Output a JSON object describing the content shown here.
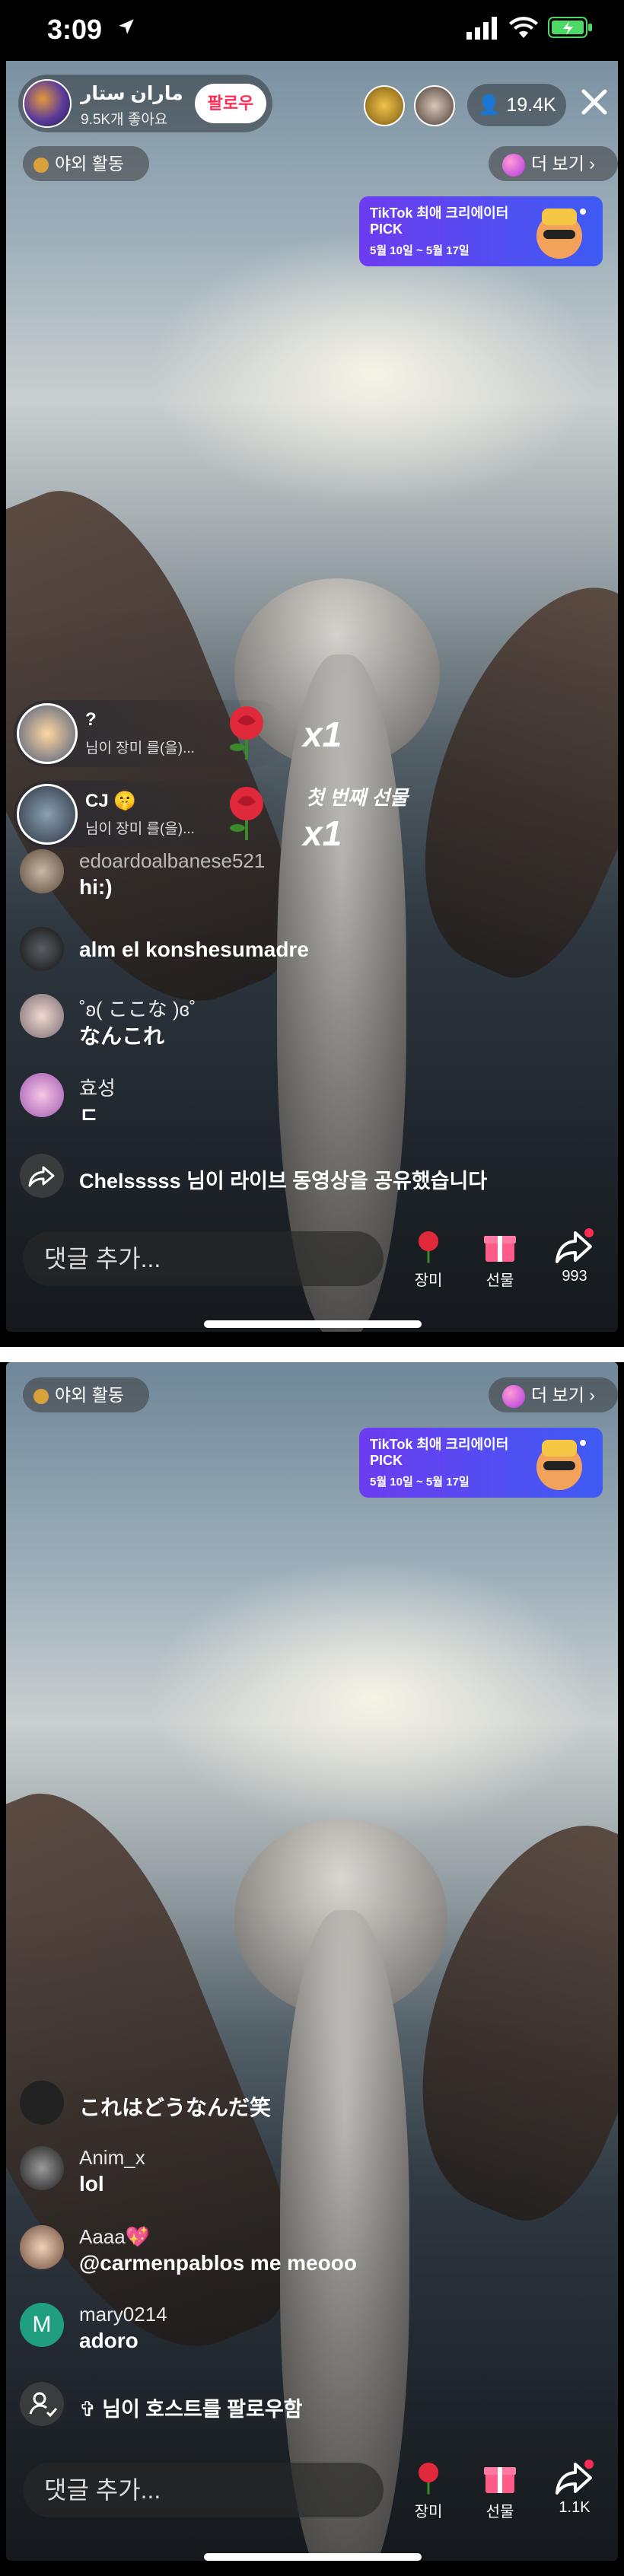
{
  "status_bar": {
    "time": "3:09"
  },
  "host": {
    "name": "ماران ستار",
    "likes": "9.5K개 좋아요",
    "follow_label": "팔로우"
  },
  "viewers": {
    "count": "19.4K"
  },
  "category_label": "야외 활동",
  "more_label": "더 보기",
  "banner": {
    "line1": "TikTok 최애 크리에이터",
    "line2": "PICK",
    "dates": "5월 10일 ~ 5월 17일"
  },
  "screen1": {
    "gifts": [
      {
        "name": "?",
        "sub": "님이 장미 를(을)...",
        "count": "x1"
      },
      {
        "name": "CJ 🤫",
        "sub": "님이 장미 를(을)...",
        "count": "x1",
        "note": "첫 번째 선물"
      }
    ],
    "comments": [
      {
        "name": "edoardoalbanese521",
        "text": "hi:)"
      },
      {
        "name": "",
        "text": "alm el konshesumadre"
      },
      {
        "name": "˚ʚ(  ここな  )ɞ˚",
        "text": "なんこれ"
      },
      {
        "name": "효성",
        "text": "ㄷ"
      },
      {
        "name": "",
        "text": "Chelsssss 님이 라이브 동영상을 공유했습니다"
      }
    ],
    "input_placeholder": "댓글 추가...",
    "actions": {
      "rose": "장미",
      "gift": "선물",
      "share": "993"
    }
  },
  "screen2": {
    "comments": [
      {
        "name": "",
        "text": "これはどうなんだ笑"
      },
      {
        "name": "Anim_x",
        "text": "lol"
      },
      {
        "name": "Aaaa💖",
        "text": "@carmenpablos me meooo"
      },
      {
        "name": "mary0214",
        "text": "adoro",
        "initial": "M"
      },
      {
        "name": "",
        "text": "✞ 님이 호스트를 팔로우함"
      }
    ],
    "input_placeholder": "댓글 추가...",
    "actions": {
      "rose": "장미",
      "gift": "선물",
      "share": "1.1K"
    }
  },
  "colors": {
    "follow": "#fe2c55",
    "banner_start": "#6d3cf0",
    "banner_end": "#3e5bf3",
    "battery": "#4cd964"
  }
}
